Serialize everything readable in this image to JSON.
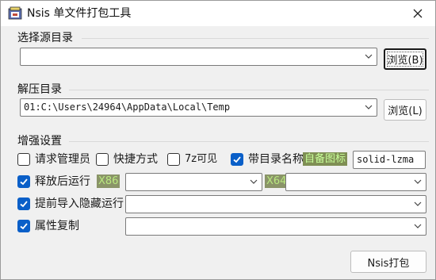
{
  "window": {
    "title": "Nsis 单文件打包工具"
  },
  "source_group": {
    "label": "选择源目录",
    "path_value": "",
    "browse_label": "浏览(B)"
  },
  "extract_group": {
    "label": "解压目录",
    "path_value": "01:C:\\Users\\24964\\AppData\\Local\\Temp",
    "browse_label": "浏览(L)"
  },
  "options_group": {
    "label": "增强设置",
    "request_admin": {
      "label": "请求管理员",
      "checked": false
    },
    "shortcut": {
      "label": "快捷方式",
      "checked": false
    },
    "visible_7z": {
      "label": "7z可见",
      "checked": false
    },
    "with_dir_name": {
      "label": "带目录名称",
      "checked": true
    },
    "custom_icon_tag": "自备图标",
    "compression_value": "solid-lzma",
    "run_after_release": {
      "label": "释放后运行",
      "checked": true
    },
    "x86_tag": "X86",
    "x86_value": "",
    "x64_tag": "X64",
    "x64_value": "",
    "pre_import_hidden": {
      "label": "提前导入隐藏运行",
      "checked": true
    },
    "pre_import_value": "",
    "attr_copy": {
      "label": "属性复制",
      "checked": true
    },
    "attr_copy_value": ""
  },
  "footer": {
    "pack_label": "Nsis打包"
  },
  "colors": {
    "accent": "#0a5fc8",
    "tag_bg": "#7f8f54",
    "tag_fg": "#c8ff9a"
  }
}
